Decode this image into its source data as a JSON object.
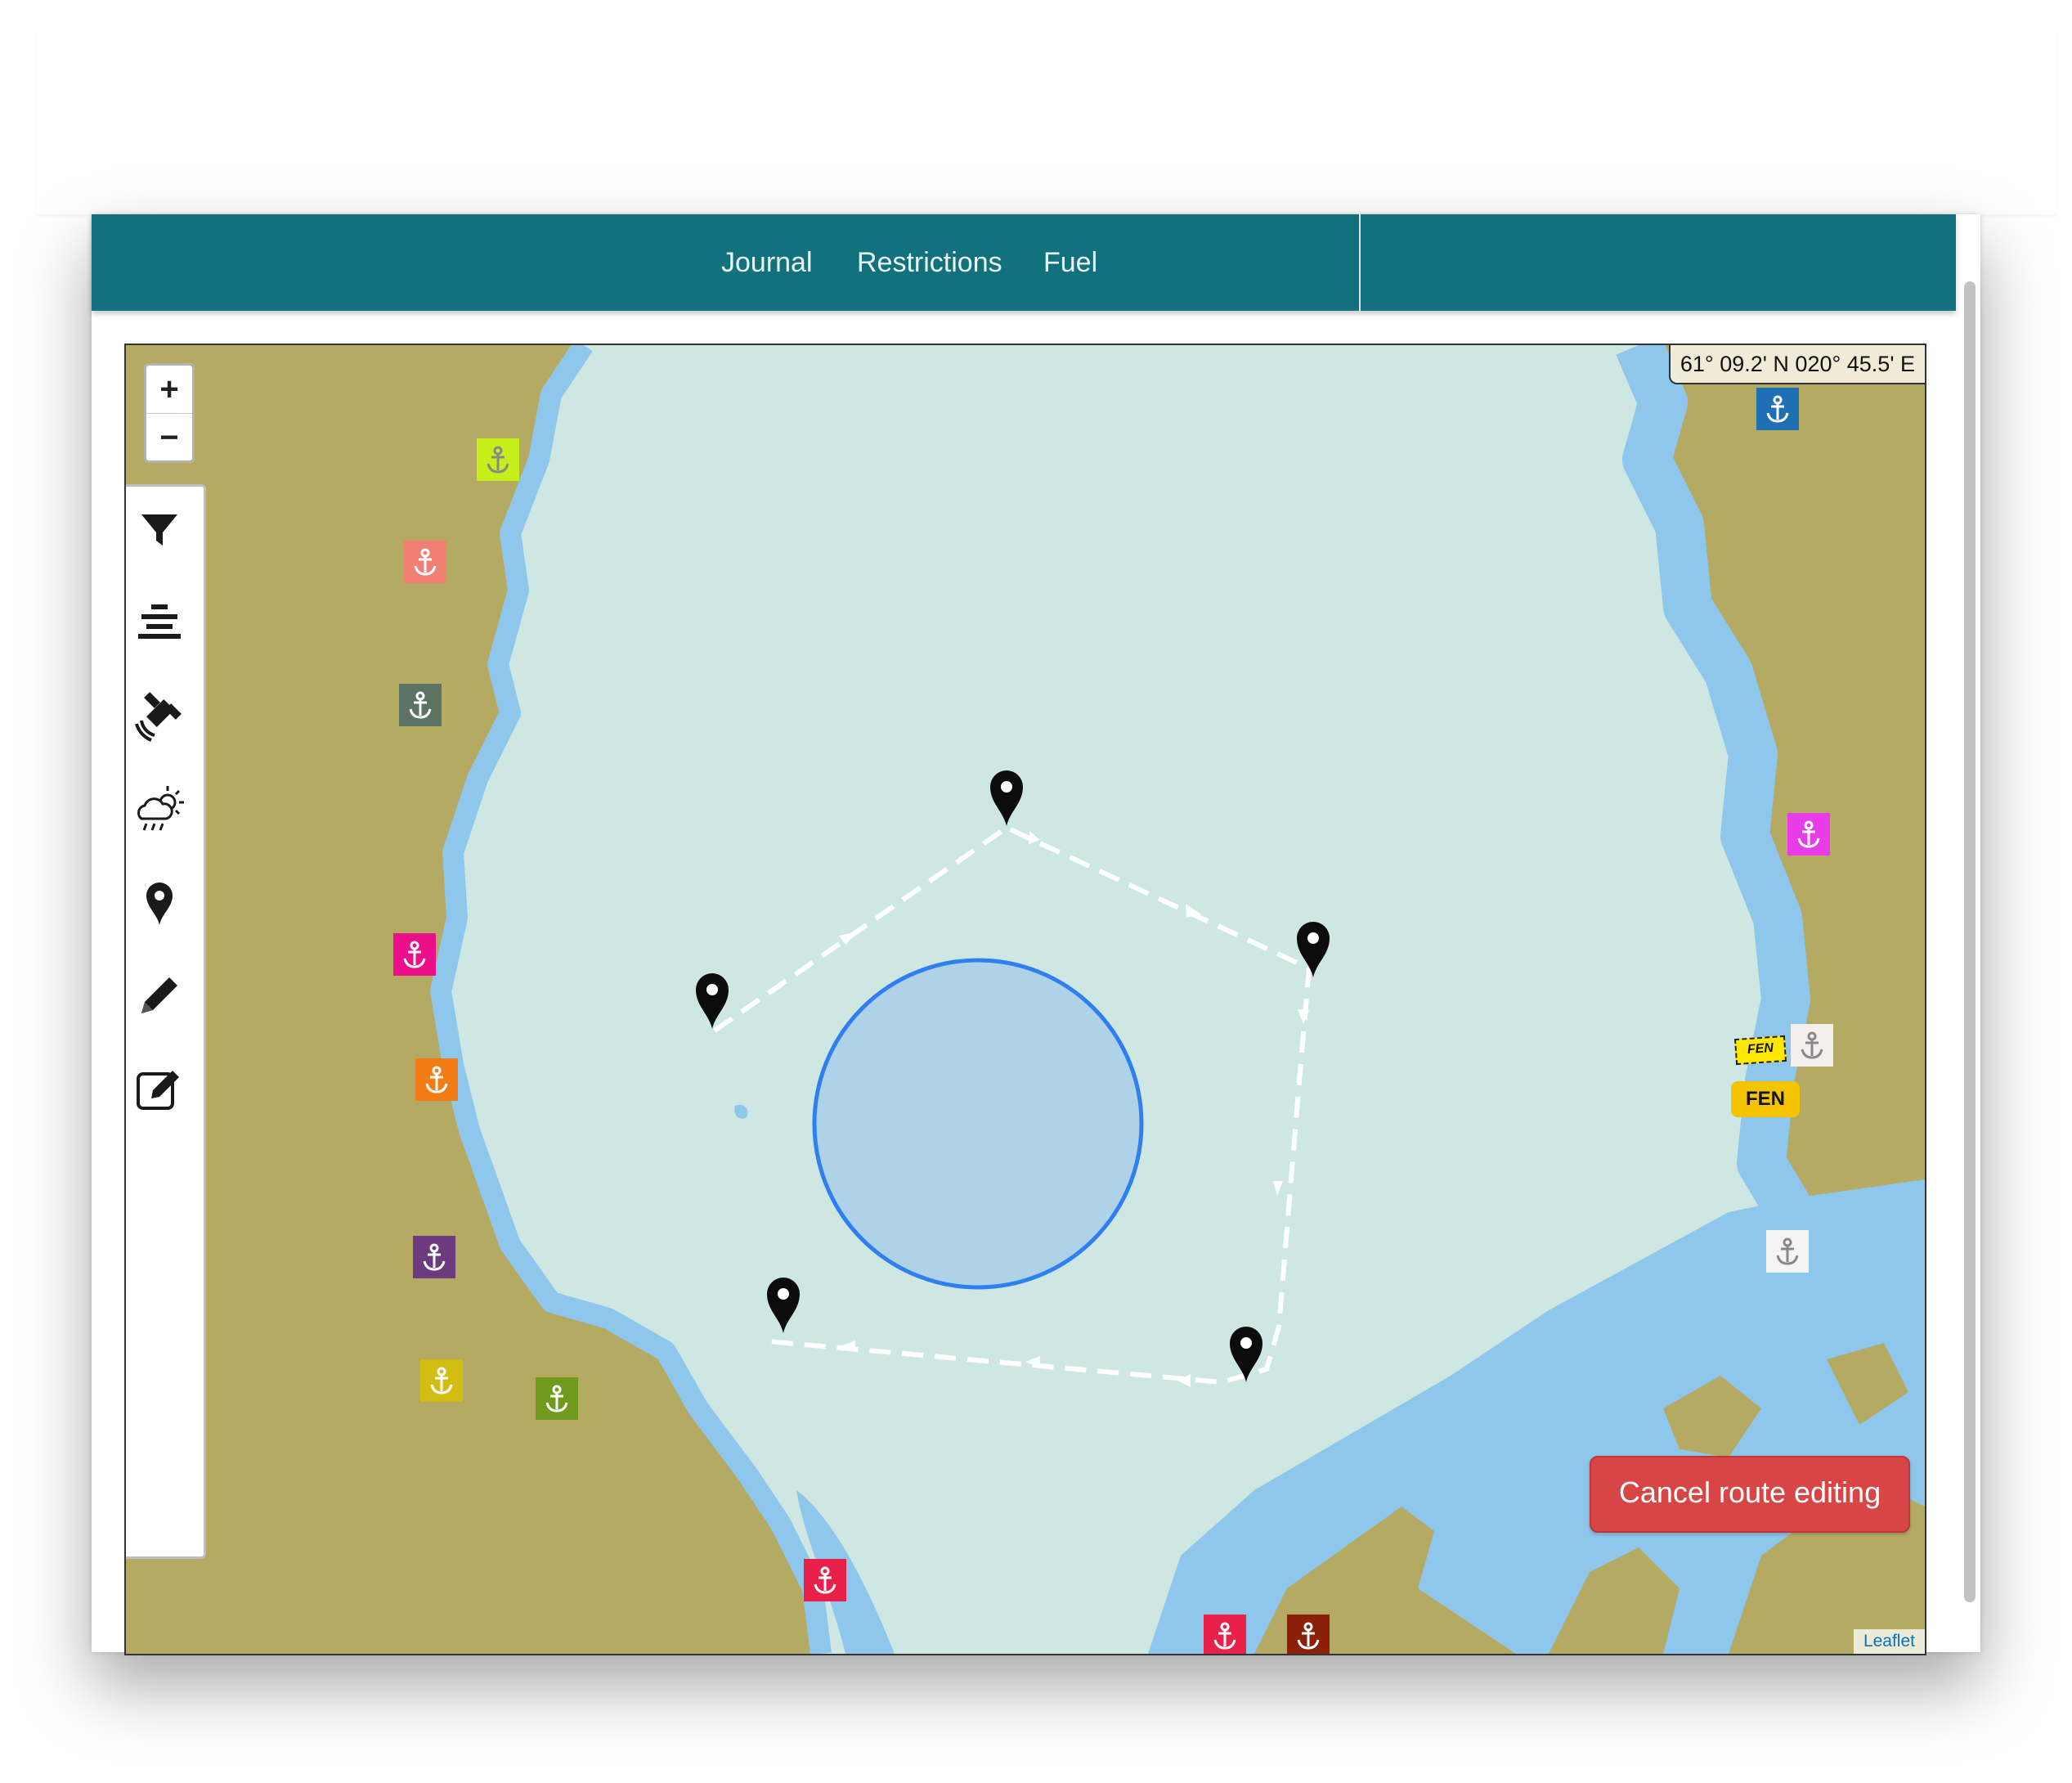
{
  "nav": {
    "journal_label": "Journal",
    "restrictions_label": "Restrictions",
    "fuel_label": "Fuel",
    "color": "#12717c"
  },
  "map": {
    "zoom_in_label": "+",
    "zoom_out_label": "−",
    "coordinates": "61° 09.2' N 020° 45.5' E",
    "cancel_label": "Cancel route editing",
    "attribution": "Leaflet",
    "fen_badge": "FEN",
    "fen_tag": "FEN",
    "colors": {
      "land": "#b5aa64",
      "sea": "#cfe7e3",
      "shallow": "#8ec6ec",
      "route": "#ffffff",
      "area_fill": "#aed3e8",
      "area_stroke": "#2f7ff0",
      "cancel_button": "#d84545"
    },
    "toolbar_tools": [
      {
        "name": "filter-icon"
      },
      {
        "name": "layers-icon"
      },
      {
        "name": "satellite-icon"
      },
      {
        "name": "weather-icon"
      },
      {
        "name": "map-pin-icon"
      },
      {
        "name": "pencil-icon"
      },
      {
        "name": "edit-square-icon"
      }
    ],
    "harbours": [
      {
        "color": "#c7ef1a"
      },
      {
        "color": "#f27f74"
      },
      {
        "color": "#5c7262"
      },
      {
        "color": "#ec0f8c"
      },
      {
        "color": "#f47c14"
      },
      {
        "color": "#6c3a7e"
      },
      {
        "color": "#d4bd12"
      },
      {
        "color": "#6f9a1c"
      },
      {
        "color": "#e8204a"
      },
      {
        "color": "#8a2008"
      },
      {
        "color": "#1e6fb4"
      },
      {
        "color": "#e83ce8"
      },
      {
        "color": "#f4eeee"
      },
      {
        "color": "#f4f4f4"
      },
      {
        "color": "#e8204a"
      },
      {
        "color": "#8a2008"
      }
    ]
  }
}
